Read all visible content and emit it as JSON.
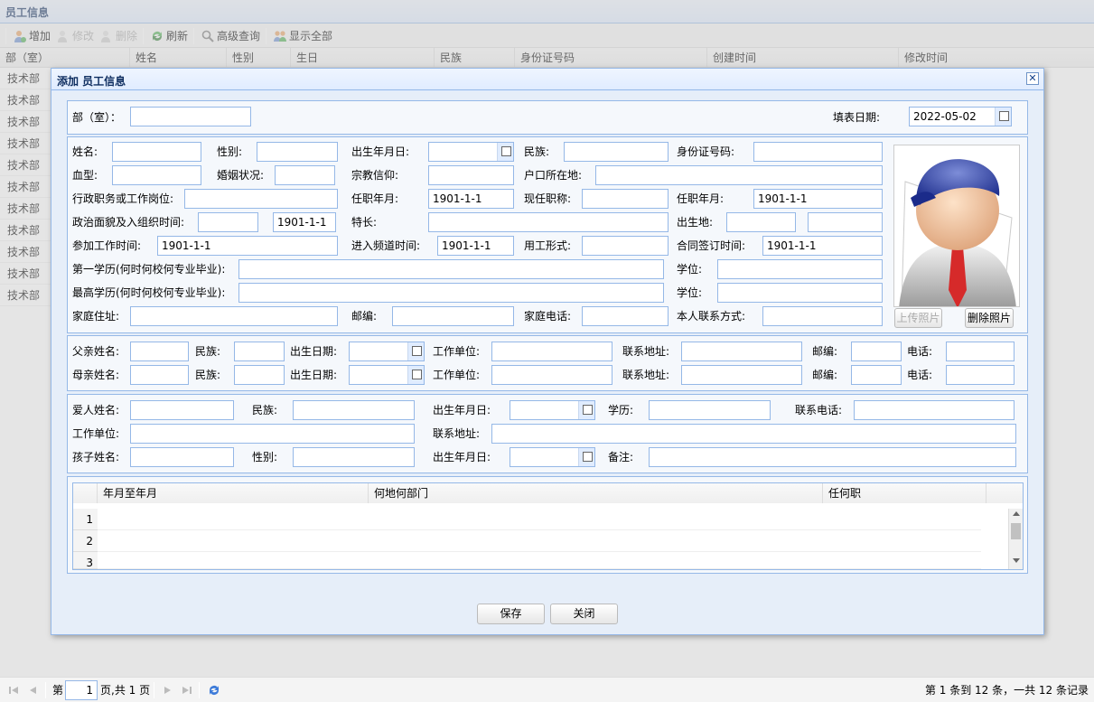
{
  "panel": {
    "title": "员工信息"
  },
  "toolbar": {
    "add": "增加",
    "edit": "修改",
    "delete": "删除",
    "refresh": "刷新",
    "advanced_search": "高级查询",
    "show_all": "显示全部"
  },
  "grid": {
    "columns": [
      "部（室）",
      "姓名",
      "性别",
      "生日",
      "民族",
      "身份证号码",
      "创建时间",
      "修改时间"
    ],
    "rows": [
      "技术部",
      "技术部",
      "技术部",
      "技术部",
      "技术部",
      "技术部",
      "技术部",
      "技术部",
      "技术部",
      "技术部",
      "技术部"
    ]
  },
  "pager": {
    "page_label_before": "第",
    "page_value": "1",
    "page_label_after": "页,共 1 页",
    "summary": "第 1 条到 12 条，一共 12 条记录"
  },
  "dialog": {
    "title": "添加 员工信息",
    "close_icon": "close-icon",
    "dept_label": "部（室）：",
    "fill_date_label": "填表日期:",
    "fill_date_value": "2022-05-02",
    "basic": {
      "name": "姓名:",
      "gender": "性别:",
      "birth_date": "出生年月日:",
      "ethnicity": "民族:",
      "id_number": "身份证号码:",
      "blood_type": "血型:",
      "marital": "婚姻状况:",
      "religion": "宗教信仰:",
      "hukou": "户口所在地:",
      "position": "行政职务或工作岗位:",
      "appoint_date": "任职年月:",
      "appoint_date_value": "1901-1-1",
      "title": "现任职称:",
      "title_date": "任职年月:",
      "title_date_value": "1901-1-1",
      "political": "政治面貌及入组织时间:",
      "political_date_value": "1901-1-1",
      "specialty": "特长:",
      "birthplace": "出生地:",
      "work_start": "参加工作时间:",
      "work_start_value": "1901-1-1",
      "join_channel": "进入频道时间:",
      "join_channel_value": "1901-1-1",
      "employment_type": "用工形式:",
      "contract_date": "合同签订时间:",
      "contract_date_value": "1901-1-1",
      "first_edu": "第一学历(何时何校何专业毕业):",
      "degree1": "学位:",
      "highest_edu": "最高学历(何时何校何专业毕业):",
      "degree2": "学位:",
      "home_address": "家庭住址:",
      "postcode": "邮编:",
      "home_phone": "家庭电话:",
      "contact": "本人联系方式:"
    },
    "photo": {
      "upload": "上传照片",
      "delete": "删除照片"
    },
    "parents": {
      "father_name": "父亲姓名:",
      "mother_name": "母亲姓名:",
      "ethnicity": "民族:",
      "birth_date": "出生日期:",
      "workplace": "工作单位:",
      "address": "联系地址:",
      "postcode": "邮编:",
      "phone": "电话:"
    },
    "spouse": {
      "name": "爱人姓名:",
      "ethnicity": "民族:",
      "birth_date": "出生年月日:",
      "education": "学历:",
      "phone": "联系电话:",
      "workplace": "工作单位:",
      "address": "联系地址:",
      "child_name": "孩子姓名:",
      "gender": "性别:",
      "child_birth": "出生年月日:",
      "remark": "备注:"
    },
    "resume_table": {
      "columns": [
        "年月至年月",
        "何地何部门",
        "任何职"
      ],
      "row_numbers": [
        "1",
        "2",
        "3"
      ]
    },
    "buttons": {
      "save": "保存",
      "close": "关闭"
    }
  }
}
